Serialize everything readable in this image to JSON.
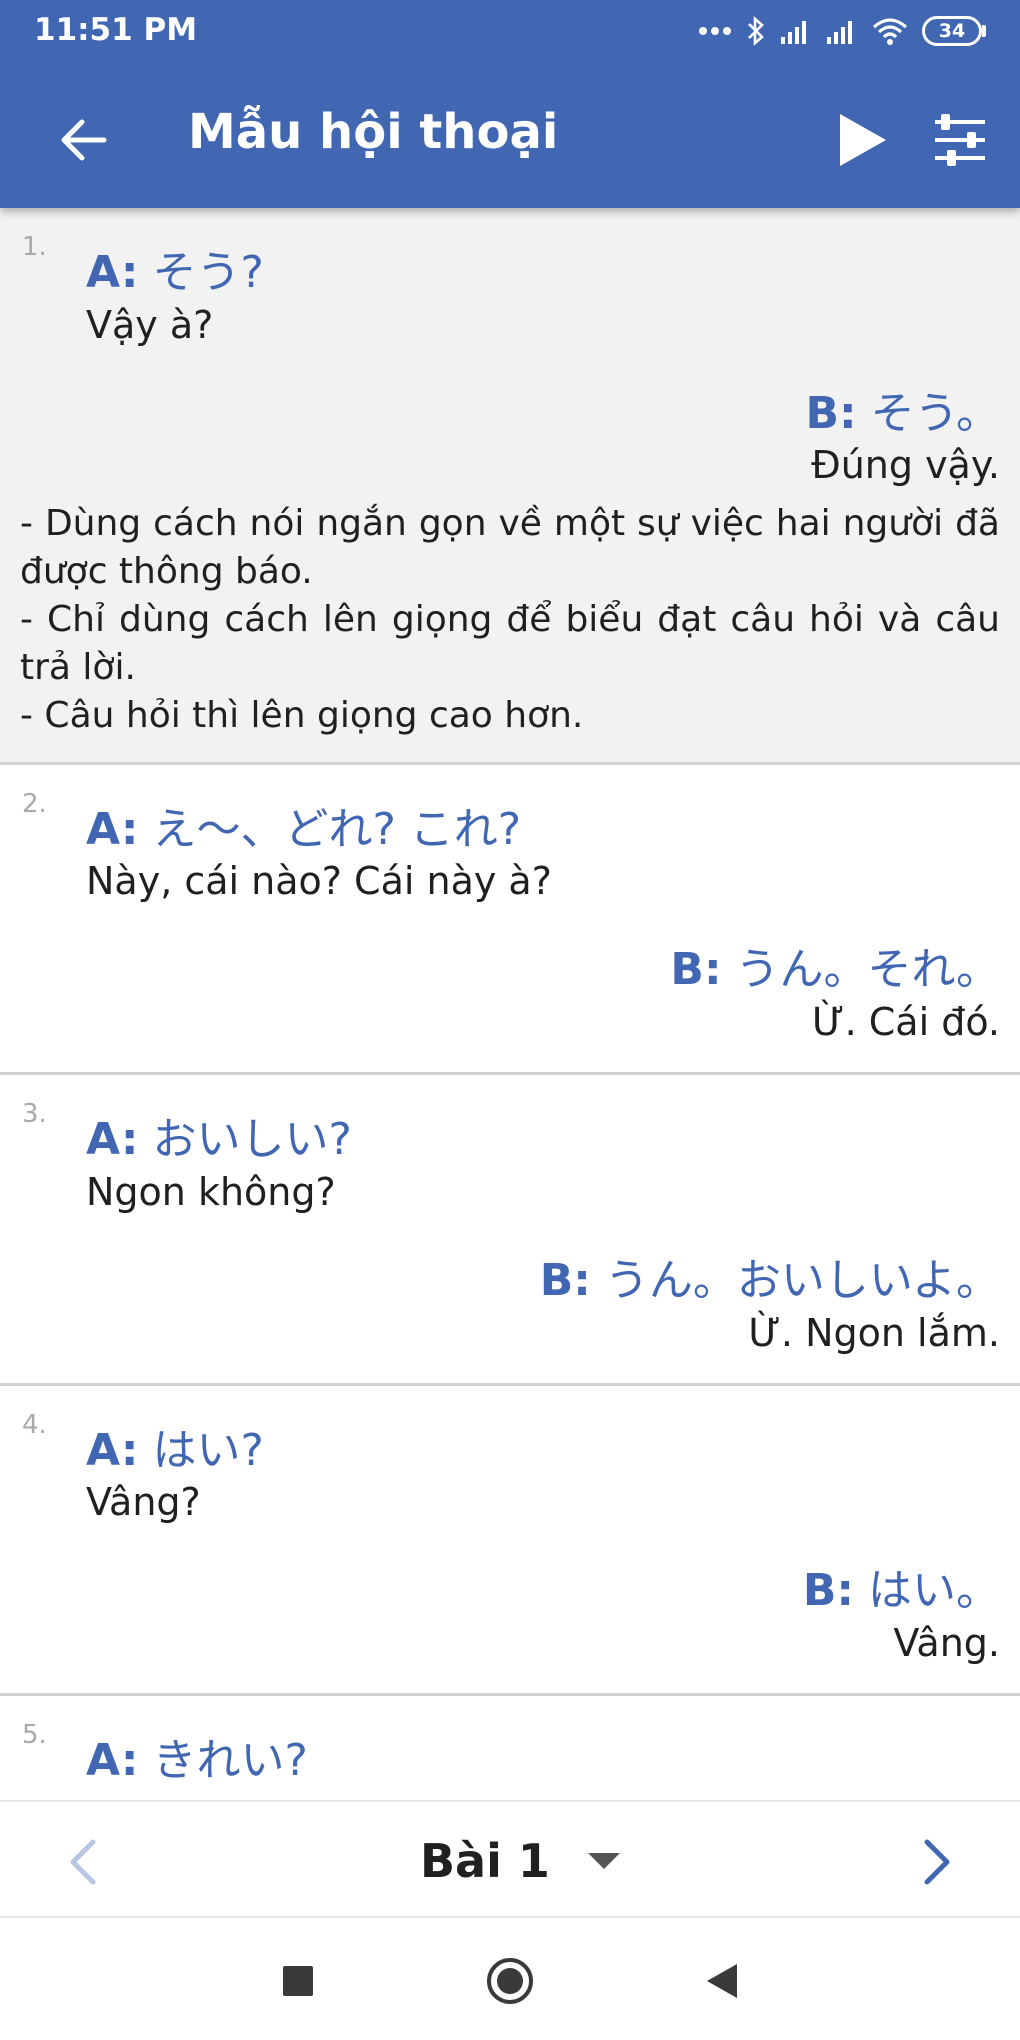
{
  "status_bar": {
    "time": "11:51 PM",
    "battery": "34"
  },
  "app_bar": {
    "title": "Mẫu hội thoại"
  },
  "dialogues": [
    {
      "number": "1.",
      "a_label": "A:",
      "a_text": "そう?",
      "a_translation": "Vậy à?",
      "b_label": "B:",
      "b_text": "そう。",
      "b_translation": "Đúng vậy.",
      "notes": [
        "- Dùng cách nói ngắn gọn về một sự việc hai người đã được thông báo.",
        "- Chỉ dùng cách lên giọng để biểu đạt câu hỏi và câu trả lời.",
        "- Câu hỏi thì lên giọng cao hơn."
      ]
    },
    {
      "number": "2.",
      "a_label": "A:",
      "a_text": "え〜、どれ? これ?",
      "a_translation": "Này, cái nào? Cái này à?",
      "b_label": "B:",
      "b_text": "うん。それ。",
      "b_translation": "Ừ. Cái đó."
    },
    {
      "number": "3.",
      "a_label": "A:",
      "a_text": "おいしい?",
      "a_translation": "Ngon không?",
      "b_label": "B:",
      "b_text": "うん。おいしいよ。",
      "b_translation": "Ừ. Ngon lắm."
    },
    {
      "number": "4.",
      "a_label": "A:",
      "a_text": "はい?",
      "a_translation": "Vâng?",
      "b_label": "B:",
      "b_text": "はい。",
      "b_translation": "Vâng."
    },
    {
      "number": "5.",
      "a_label": "A:",
      "a_text": "きれい?"
    }
  ],
  "bottom_bar": {
    "lesson": "Bài 1"
  },
  "colors": {
    "primary": "#4267b2",
    "highlight_bg": "#f2f2f2"
  },
  "icons": {
    "back": "arrow-left",
    "play": "play",
    "settings": "sliders",
    "prev": "chevron-left",
    "next": "chevron-right",
    "dropdown": "caret-down"
  }
}
